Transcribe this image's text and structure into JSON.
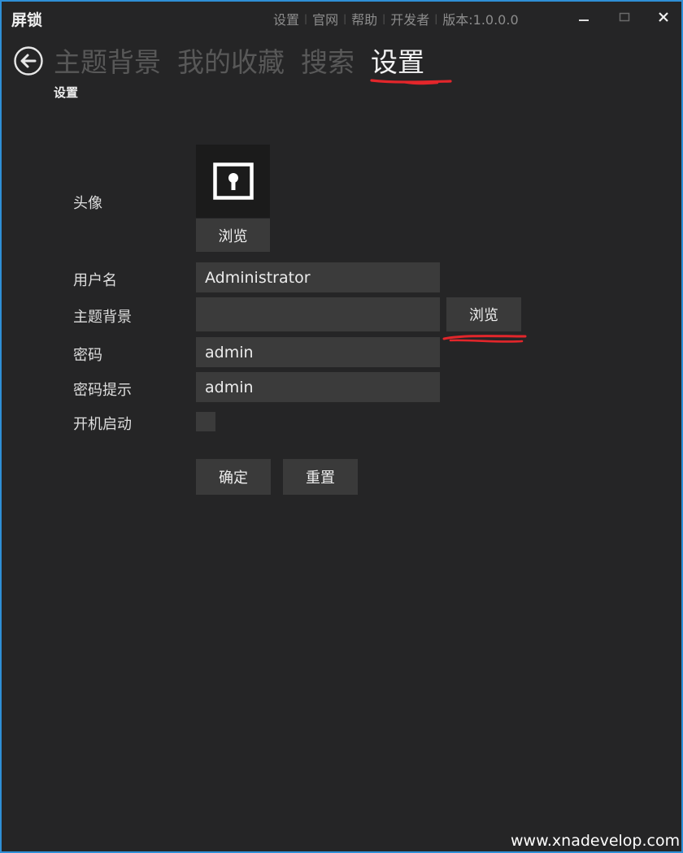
{
  "window": {
    "app_title": "屏锁",
    "top_menu": [
      "设置",
      "官网",
      "帮助",
      "开发者",
      "版本:1.0.0.0"
    ],
    "controls": {
      "minimize": "minimize-icon",
      "maximize": "maximize-icon",
      "close": "close-icon"
    }
  },
  "nav": {
    "back_icon": "back-arrow-icon",
    "tabs": [
      "主题背景",
      "我的收藏",
      "搜索",
      "设置"
    ],
    "active_tab": "设置"
  },
  "page": {
    "subtitle": "设置"
  },
  "form": {
    "avatar_label": "头像",
    "avatar_icon": "keyhole-lock-icon",
    "avatar_browse_label": "浏览",
    "username_label": "用户名",
    "username_value": "Administrator",
    "theme_label": "主题背景",
    "theme_value": "",
    "theme_browse_label": "浏览",
    "password_label": "密码",
    "password_value": "admin",
    "hint_label": "密码提示",
    "hint_value": "admin",
    "autostart_label": "开机启动",
    "autostart_checked": false,
    "confirm_label": "确定",
    "reset_label": "重置"
  },
  "annotations": {
    "color": "#e3262b"
  },
  "watermark": "www.xnadevelop.com",
  "colors": {
    "background": "#252526",
    "border": "#2f8fd6",
    "field": "#3b3b3b",
    "button": "#3a3a3a"
  }
}
